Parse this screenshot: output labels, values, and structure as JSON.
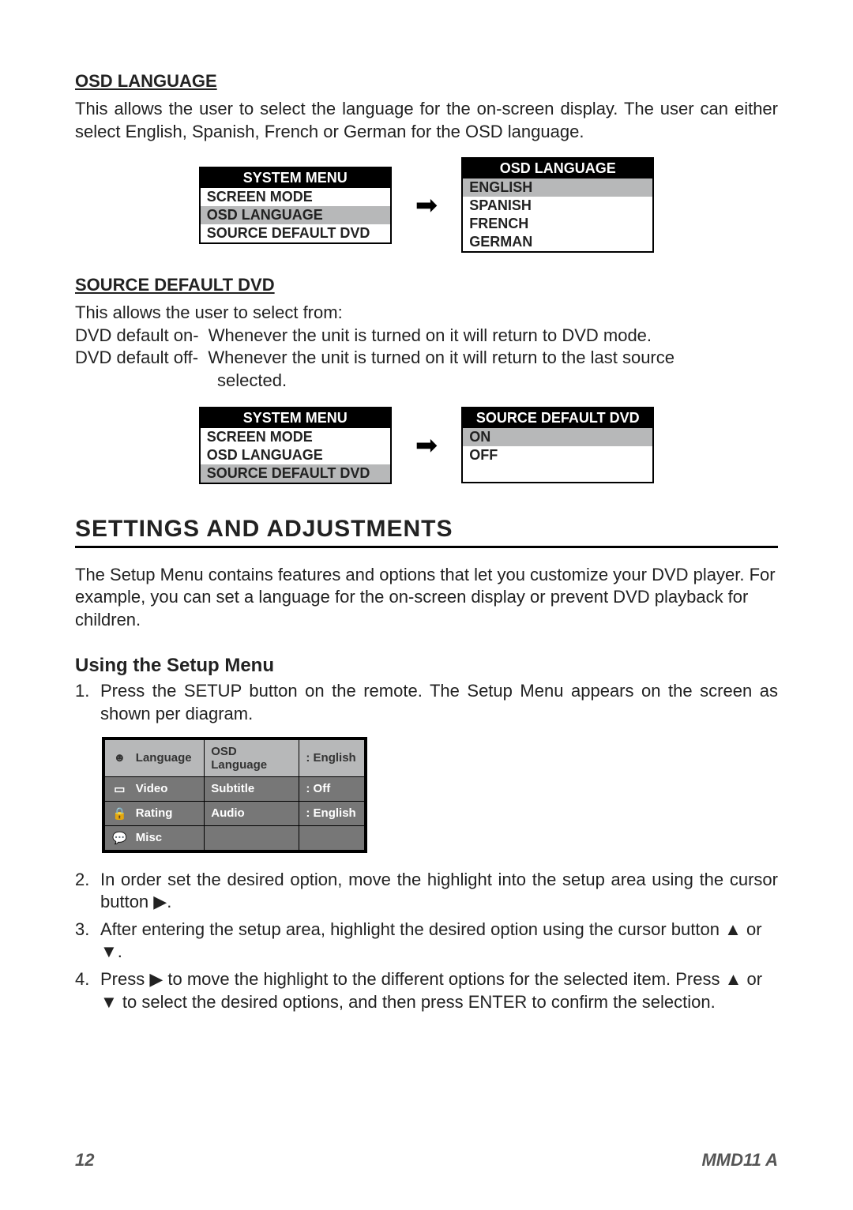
{
  "osd": {
    "heading": "OSD LANGUAGE",
    "desc": "This allows the user to select the language for the on-screen display. The user can either select English, Spanish, French or German for the OSD language.",
    "menu_left_header": "SYSTEM MENU",
    "menu_left_items": [
      "SCREEN MODE",
      "OSD LANGUAGE",
      "SOURCE DEFAULT DVD"
    ],
    "menu_right_header": "OSD LANGUAGE",
    "menu_right_items": [
      "ENGLISH",
      "SPANISH",
      "FRENCH",
      "GERMAN"
    ]
  },
  "sdd": {
    "heading": "SOURCE DEFAULT DVD",
    "intro": "This allows the user to select from:",
    "def_on_label": "DVD default on-",
    "def_on_text": "Whenever the unit is turned on it will return to DVD mode.",
    "def_off_label": "DVD default off-",
    "def_off_text1": "Whenever the unit is turned on it will return to the last source",
    "def_off_text2": "selected.",
    "menu_left_header": "SYSTEM MENU",
    "menu_left_items": [
      "SCREEN MODE",
      "OSD LANGUAGE",
      "SOURCE DEFAULT DVD"
    ],
    "menu_right_header": "SOURCE DEFAULT DVD",
    "menu_right_items": [
      "ON",
      "OFF"
    ]
  },
  "settings": {
    "title": "SETTINGS AND ADJUSTMENTS",
    "intro": "The Setup Menu contains features and options that let you customize your DVD player. For example, you can set a language for the on-screen display or prevent DVD playback for children.",
    "using_title": "Using the Setup Menu",
    "step1": "Press the SETUP button on the remote. The Setup Menu appears on the screen as shown per diagram.",
    "step2a": "In order set the desired option, move the highlight into the setup area using the cursor button ",
    "step2b": ".",
    "step3a": "After entering the setup area, highlight the desired option using the cursor button ",
    "step3b": " or ",
    "step3c": ".",
    "step4a": "Press ",
    "step4b": " to move the highlight to the different options for the selected item. Press ",
    "step4c": " or ",
    "step4d": " to select the desired options, and then press ENTER to confirm the selection."
  },
  "setup_menu": {
    "tabs": [
      {
        "icon": "☻",
        "label": "Language"
      },
      {
        "icon": "▭",
        "label": "Video"
      },
      {
        "icon": "🔒",
        "label": "Rating"
      },
      {
        "icon": "💬",
        "label": "Misc"
      }
    ],
    "options": [
      {
        "name": "OSD Language",
        "value": ": English"
      },
      {
        "name": "Subtitle",
        "value": ": Off"
      },
      {
        "name": "Audio",
        "value": ": English"
      }
    ]
  },
  "footer": {
    "page": "12",
    "model": "MMD11 A"
  }
}
